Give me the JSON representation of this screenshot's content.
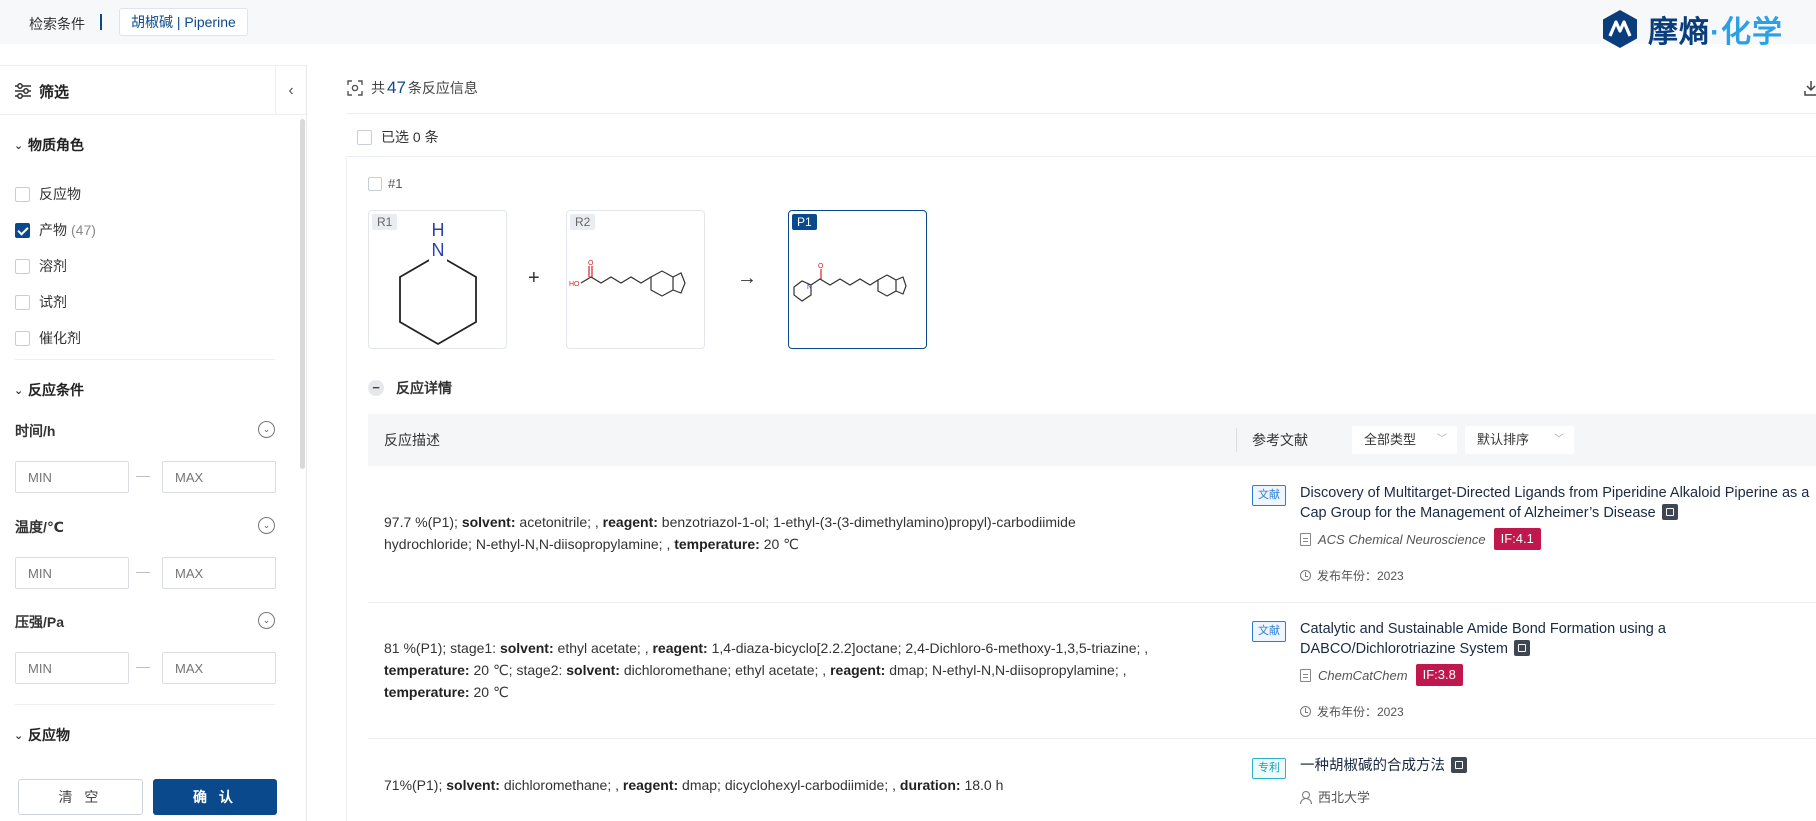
{
  "header": {
    "crumb_label": "检索条件",
    "crumb_tag": "胡椒碱 | Piperine",
    "brand_a": "摩熵",
    "brand_b": "·化学"
  },
  "sidebar": {
    "title": "筛选",
    "role_section": "物质角色",
    "roles": [
      {
        "label": "反应物",
        "count": "",
        "checked": false
      },
      {
        "label": "产物",
        "count": "(47)",
        "checked": true
      },
      {
        "label": "溶剂",
        "count": "",
        "checked": false
      },
      {
        "label": "试剂",
        "count": "",
        "checked": false
      },
      {
        "label": "催化剂",
        "count": "",
        "checked": false
      }
    ],
    "cond_section": "反应条件",
    "params": [
      {
        "label": "时间/h",
        "min_placeholder": "MIN",
        "max_placeholder": "MAX"
      },
      {
        "label": "温度/℃",
        "min_placeholder": "MIN",
        "max_placeholder": "MAX"
      },
      {
        "label": "压强/Pa",
        "min_placeholder": "MIN",
        "max_placeholder": "MAX"
      }
    ],
    "dash": "—",
    "reactant_section": "反应物",
    "clear_label": "清 空",
    "confirm_label": "确 认"
  },
  "main": {
    "count_prefix": "共",
    "count": "47",
    "count_suffix": "条反应信息",
    "selected_text": "已选 0 条",
    "card_id": "#1",
    "molecules": [
      {
        "tag": "R1",
        "atom_label": "N",
        "atom_label2": "H"
      },
      {
        "tag": "R2",
        "atom_label": "HO",
        "atom_label2": "O"
      },
      {
        "tag": "P1",
        "atom_label": "N",
        "atom_label2": "O"
      }
    ],
    "plus": "+",
    "arrow": "→",
    "detail_toggle": "反应详情",
    "table": {
      "col_desc": "反应描述",
      "col_ref": "参考文献",
      "filter_type": "全部类型",
      "filter_sort": "默认排序"
    },
    "rows": [
      {
        "line1_a": "97.7 %(P1); ",
        "line1_b": "solvent:",
        "line1_c": " acetonitrile; , ",
        "line1_d": "reagent:",
        "line1_e": " benzotriazol-1-ol; 1-ethyl-(3-(3-dimethylamino)propyl)-carbodiimide",
        "line2_a": "hydrochloride; N-ethyl-N,N-diisopropylamine; , ",
        "line2_b": "temperature:",
        "line2_c": " 20 ℃",
        "ref_badge": "文献",
        "ref_title": "Discovery of Multitarget-Directed Ligands from Piperidine Alkaloid Piperine as a Cap Group for the Management of Alzheimer’s Disease",
        "ref_journal": "ACS Chemical Neuroscience",
        "ref_if": "IF:4.1",
        "ref_year": "发布年份：2023"
      },
      {
        "line1_a": "81 %(P1); stage1: ",
        "line1_b": "solvent:",
        "line1_c": " ethyl acetate; , ",
        "line1_d": "reagent:",
        "line1_e": " 1,4-diaza-bicyclo[2.2.2]octane; 2,4-Dichloro-6-methoxy-1,3,5-triazine; ,",
        "line2_a": "temperature:",
        "line2_b": " 20 ℃; stage2: ",
        "line2_c": "solvent:",
        "line2_d": " dichloromethane; ethyl acetate; , ",
        "line2_e": "reagent:",
        "line2_f": " dmap; N-ethyl-N,N-diisopropylamine; ,",
        "line3_a": "temperature:",
        "line3_b": " 20 ℃",
        "ref_badge": "文献",
        "ref_title": "Catalytic and Sustainable Amide Bond Formation using a DABCO/Dichlorotriazine System",
        "ref_journal": "ChemCatChem",
        "ref_if": "IF:3.8",
        "ref_year": "发布年份：2023"
      },
      {
        "line1_a": "71%(P1); ",
        "line1_b": "solvent:",
        "line1_c": " dichloromethane; , ",
        "line1_d": "reagent:",
        "line1_e": " dmap; dicyclohexyl-carbodiimide; , ",
        "line1_f": "duration:",
        "line1_g": " 18.0 h",
        "ref_badge": "专利",
        "ref_title": "一种胡椒碱的合成方法",
        "ref_owner": "西北大学"
      }
    ]
  },
  "colors": {
    "primary": "#0a4a8c",
    "brand_light": "#2aa0e6",
    "if_badge": "#c0174d"
  }
}
